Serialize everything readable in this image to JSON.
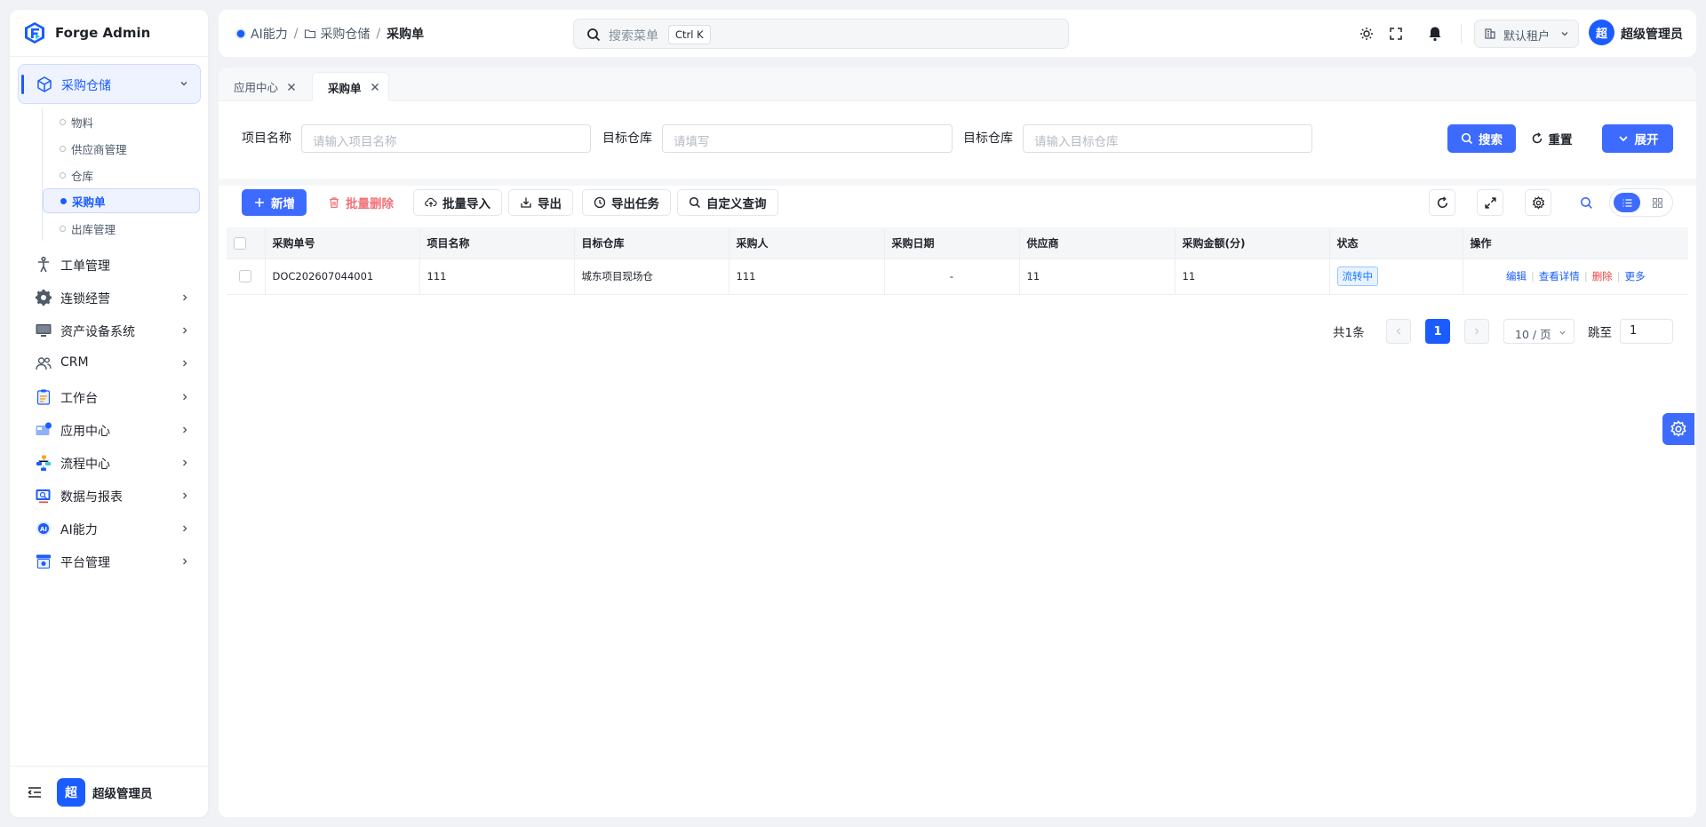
{
  "app": {
    "name": "Forge Admin"
  },
  "sidebar": {
    "active_group": {
      "label": "采购仓储",
      "children": [
        {
          "label": "物料"
        },
        {
          "label": "供应商管理"
        },
        {
          "label": "仓库"
        },
        {
          "label": "采购单",
          "active": true
        },
        {
          "label": "出库管理"
        }
      ]
    },
    "items": [
      {
        "label": "工单管理",
        "icon": "person-icon"
      },
      {
        "label": "连锁经营",
        "icon": "gear-icon"
      },
      {
        "label": "资产设备系统",
        "icon": "monitor-icon"
      },
      {
        "label": "CRM",
        "icon": "users-icon"
      },
      {
        "label": "工作台",
        "icon": "clipboard-icon"
      },
      {
        "label": "应用中心",
        "icon": "app-icon"
      },
      {
        "label": "流程中心",
        "icon": "flow-icon"
      },
      {
        "label": "数据与报表",
        "icon": "report-icon"
      },
      {
        "label": "AI能力",
        "icon": "ai-icon"
      },
      {
        "label": "平台管理",
        "icon": "platform-icon"
      }
    ],
    "footer": {
      "avatar": "超",
      "name": "超级管理员"
    }
  },
  "header": {
    "breadcrumb": [
      "AI能力",
      "采购仓储",
      "采购单"
    ],
    "search": {
      "placeholder": "搜索菜单",
      "shortcut": "Ctrl K"
    },
    "tenant": "默认租户",
    "user": {
      "avatar": "超",
      "name": "超级管理员"
    }
  },
  "tabs": [
    {
      "label": "应用中心",
      "active": false
    },
    {
      "label": "采购单",
      "active": true
    }
  ],
  "filters": [
    {
      "label": "项目名称",
      "placeholder": "请输入项目名称"
    },
    {
      "label": "目标仓库",
      "placeholder": "请填写"
    },
    {
      "label": "目标仓库",
      "placeholder": "请输入目标仓库"
    }
  ],
  "filter_actions": {
    "search": "搜索",
    "reset": "重置",
    "expand": "展开"
  },
  "toolbar": {
    "add": "新增",
    "batch_delete": "批量删除",
    "batch_import": "批量导入",
    "export": "导出",
    "export_task": "导出任务",
    "custom_query": "自定义查询"
  },
  "table": {
    "columns": [
      "采购单号",
      "项目名称",
      "目标仓库",
      "采购人",
      "采购日期",
      "供应商",
      "采购金额(分)",
      "状态",
      "操作"
    ],
    "rows": [
      {
        "order_no": "DOC202607044001",
        "project": "111",
        "warehouse": "城东项目现场仓",
        "buyer": "111",
        "date": "-",
        "supplier": "11",
        "amount": "11",
        "status": "流转中",
        "actions": [
          "编辑",
          "查看详情",
          "删除",
          "更多"
        ]
      }
    ]
  },
  "pagination": {
    "total": "共1条",
    "current": "1",
    "page_size": "10 / 页",
    "jump_label": "跳至",
    "jump_value": "1"
  },
  "colors": {
    "primary": "#3d6bff",
    "brand": "#1a5cff",
    "danger": "#f53f3f",
    "status": "#1677ff"
  }
}
